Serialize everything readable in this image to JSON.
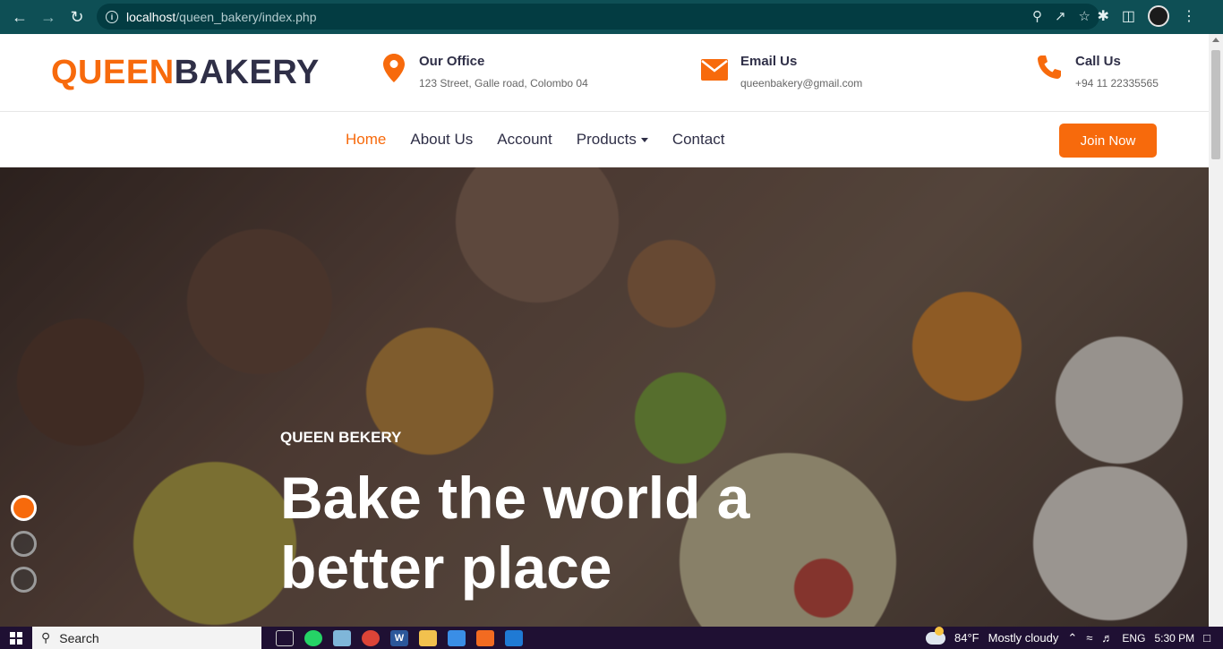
{
  "browser": {
    "url_host": "localhost",
    "url_path": "/queen_bakery/index.php"
  },
  "site": {
    "logo_part1": "QUEEN",
    "logo_part2": "BAKERY"
  },
  "contact": {
    "office": {
      "title": "Our Office",
      "detail": "123 Street, Galle road, Colombo 04",
      "icon": "map-marker-icon"
    },
    "email": {
      "title": "Email Us",
      "detail": "queenbakery@gmail.com",
      "icon": "envelope-icon"
    },
    "call": {
      "title": "Call Us",
      "detail": "+94 11 22335565",
      "icon": "phone-icon"
    }
  },
  "nav": {
    "items": [
      {
        "label": "Home",
        "active": true
      },
      {
        "label": "About Us"
      },
      {
        "label": "Account"
      },
      {
        "label": "Products",
        "dropdown": true
      },
      {
        "label": "Contact"
      }
    ],
    "cta": "Join Now"
  },
  "hero": {
    "kicker": "QUEEN BEKERY",
    "headline": "Bake the world a better place",
    "slides": 3,
    "active_slide": 1
  },
  "taskbar": {
    "search_label": "Search",
    "temperature": "84°F",
    "weather": "Mostly cloudy",
    "language": "ENG",
    "time": "5:30 PM"
  },
  "colors": {
    "accent": "#f76a0c",
    "dark": "#2f2f47",
    "chrome": "#0e4f55"
  }
}
